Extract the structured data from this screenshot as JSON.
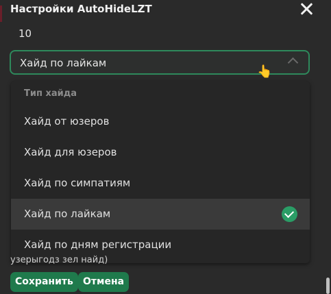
{
  "dialog": {
    "title": "Настройки AutoHideLZT",
    "number_value": "10",
    "hint_text": "узерыгодз зел найд)"
  },
  "select": {
    "value": "Хайд по лайкам"
  },
  "dropdown": {
    "header": "Тип хайда",
    "items": [
      {
        "label": "Хайд от юзеров"
      },
      {
        "label": "Хайд для юзеров"
      },
      {
        "label": "Хайд по симпатиям"
      },
      {
        "label": "Хайд по лайкам",
        "selected": true
      },
      {
        "label": "Хайд по дням регистрации"
      }
    ]
  },
  "buttons": {
    "save": "Сохранить",
    "cancel": "Отмена"
  },
  "icons": {
    "close": "close-icon",
    "chevron": "chevron-up-icon",
    "check": "check-circle-icon",
    "cursor": "hand-pointer-icon"
  },
  "colors": {
    "accent": "#2e8a5c",
    "button": "#1f7a4c",
    "check": "#2a9d66",
    "background": "#2a2a2a"
  }
}
